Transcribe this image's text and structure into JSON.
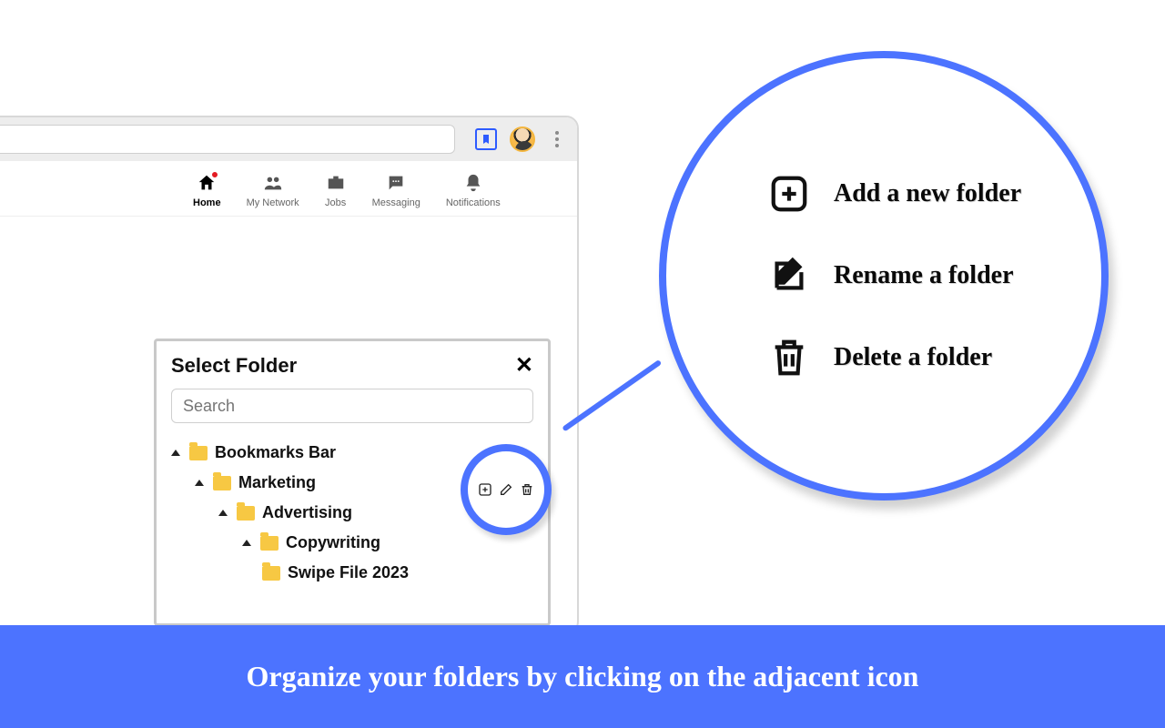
{
  "nav": {
    "items": [
      {
        "label": "Home"
      },
      {
        "label": "My Network"
      },
      {
        "label": "Jobs"
      },
      {
        "label": "Messaging"
      },
      {
        "label": "Notifications"
      }
    ]
  },
  "popup": {
    "title": "Select Folder",
    "search_placeholder": "Search",
    "tree": {
      "root": "Bookmarks Bar",
      "l1": "Marketing",
      "l2": "Advertising",
      "l3": "Copywriting",
      "l4": "Swipe File 2023"
    }
  },
  "legend": {
    "add": "Add a new folder",
    "rename": "Rename a folder",
    "delete": "Delete a folder"
  },
  "banner": "Organize your folders by clicking on the adjacent icon"
}
